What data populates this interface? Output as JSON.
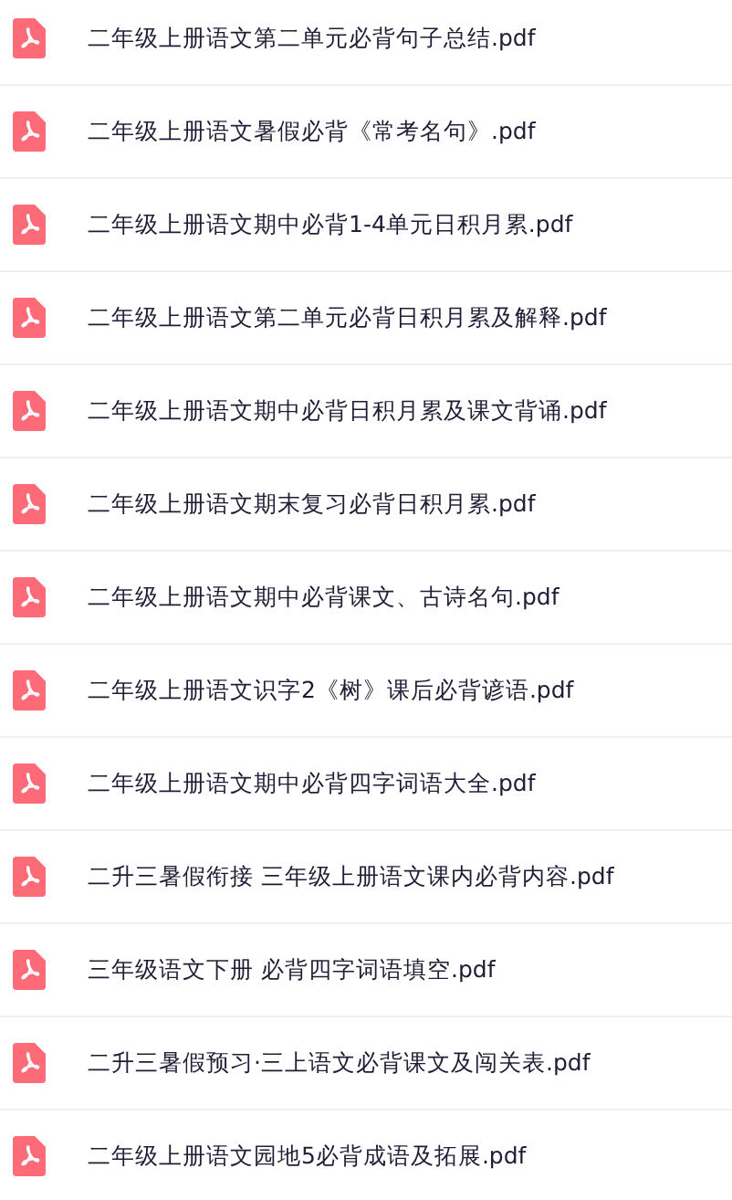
{
  "files": [
    {
      "name": "二年级上册语文第二单元必背句子总结.pdf"
    },
    {
      "name": "二年级上册语文暑假必背《常考名句》.pdf"
    },
    {
      "name": "二年级上册语文期中必背1-4单元日积月累.pdf"
    },
    {
      "name": "二年级上册语文第二单元必背日积月累及解释.pdf"
    },
    {
      "name": "二年级上册语文期中必背日积月累及课文背诵.pdf"
    },
    {
      "name": "二年级上册语文期末复习必背日积月累.pdf"
    },
    {
      "name": "二年级上册语文期中必背课文、古诗名句.pdf"
    },
    {
      "name": "二年级上册语文识字2《树》课后必背谚语.pdf"
    },
    {
      "name": "二年级上册语文期中必背四字词语大全.pdf"
    },
    {
      "name": "二升三暑假衔接 三年级上册语文课内必背内容.pdf"
    },
    {
      "name": "三年级语文下册 必背四字词语填空.pdf"
    },
    {
      "name": "二升三暑假预习·三上语文必背课文及闯关表.pdf"
    },
    {
      "name": "二年级上册语文园地5必背成语及拓展.pdf"
    }
  ]
}
